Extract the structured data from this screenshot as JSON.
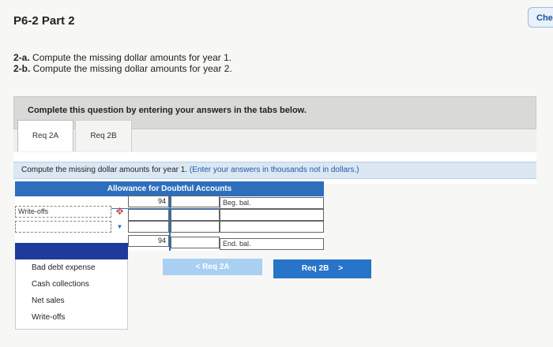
{
  "header": {
    "title": "P6-2 Part 2",
    "check_label": "Che"
  },
  "instructions": [
    {
      "label": "2-a.",
      "text": " Compute the missing dollar amounts for year 1."
    },
    {
      "label": "2-b.",
      "text": " Compute the missing dollar amounts for year 2."
    }
  ],
  "banner": "Complete this question by entering your answers in the tabs below.",
  "tabs": [
    {
      "label": "Req 2A"
    },
    {
      "label": "Req 2B"
    }
  ],
  "prompt": {
    "text": "Compute the missing dollar amounts for year 1. ",
    "note": "(Enter your answers in thousands not in dollars.)"
  },
  "t_account": {
    "title": "Allowance for Doubtful Accounts",
    "row1": {
      "value": "94",
      "label": "Beg. bal."
    },
    "row2": {
      "label": "Write-offs"
    },
    "row4": {
      "value": "94",
      "label": "End. bal."
    }
  },
  "dropdown": {
    "options": [
      "Bad debt expense",
      "Cash collections",
      "Net sales",
      "Write-offs"
    ]
  },
  "nav": {
    "prev": "Req 2A",
    "next": "Req 2B"
  }
}
